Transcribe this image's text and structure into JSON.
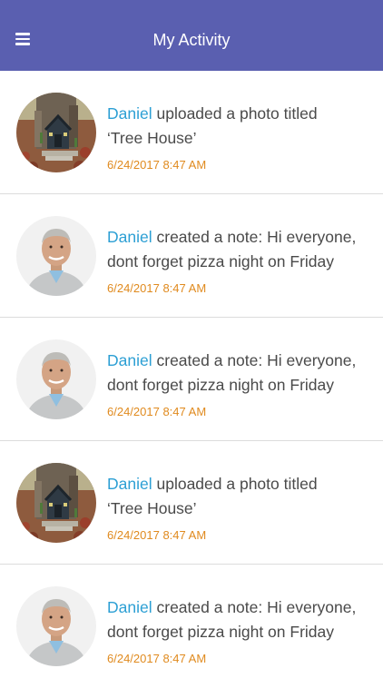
{
  "header": {
    "title": "My Activity",
    "menu_icon": "menu-icon"
  },
  "colors": {
    "header": "#5a5fb0",
    "user_link": "#2c9fd4",
    "timestamp": "#e08a1e"
  },
  "feed": [
    {
      "avatar": "tree-house-photo",
      "user": "Daniel",
      "line1": " uploaded a photo titled",
      "line2": "‘Tree House’",
      "time": "6/24/2017 8:47 AM"
    },
    {
      "avatar": "man-portrait",
      "user": "Daniel",
      "line1": " created a note: Hi everyone,",
      "line2": "dont forget pizza night on Friday",
      "time": "6/24/2017 8:47 AM"
    },
    {
      "avatar": "man-portrait",
      "user": "Daniel",
      "line1": " created a note: Hi everyone,",
      "line2": "dont forget pizza night on Friday",
      "time": "6/24/2017 8:47 AM"
    },
    {
      "avatar": "tree-house-photo",
      "user": "Daniel",
      "line1": " uploaded a photo titled",
      "line2": "‘Tree House’",
      "time": "6/24/2017 8:47 AM"
    },
    {
      "avatar": "man-portrait",
      "user": "Daniel",
      "line1": " created a note: Hi everyone,",
      "line2": "dont forget pizza night on Friday",
      "time": "6/24/2017 8:47 AM"
    }
  ]
}
